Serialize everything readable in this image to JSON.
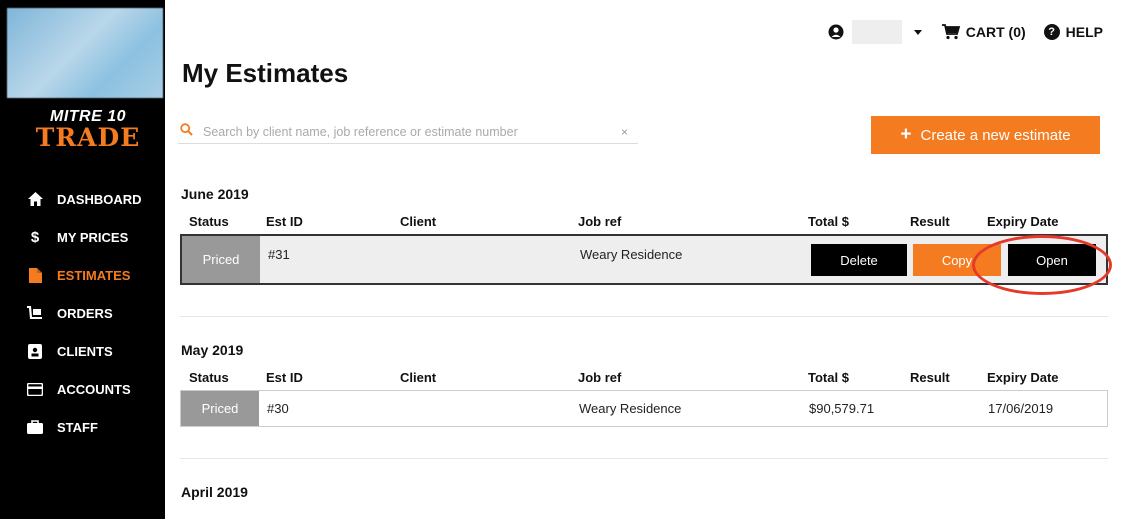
{
  "sidebar": {
    "logo_top": "MITRE 10",
    "logo_bottom": "TRADE",
    "items": [
      {
        "label": "DASHBOARD"
      },
      {
        "label": "MY PRICES"
      },
      {
        "label": "ESTIMATES"
      },
      {
        "label": "ORDERS"
      },
      {
        "label": "CLIENTS"
      },
      {
        "label": "ACCOUNTS"
      },
      {
        "label": "STAFF"
      }
    ],
    "active_item": "ESTIMATES"
  },
  "topbar": {
    "cart_label": "CART (0)",
    "help_label": "HELP"
  },
  "main": {
    "title": "My Estimates",
    "search_placeholder": "Search by client name, job reference or estimate number",
    "search_clear": "×",
    "create_label": "Create a new estimate",
    "create_plus": "+",
    "headers": {
      "status": "Status",
      "est_id": "Est ID",
      "client": "Client",
      "job_ref": "Job ref",
      "total": "Total $",
      "result": "Result",
      "expiry": "Expiry Date"
    },
    "sections": [
      {
        "month": "June 2019",
        "rows": [
          {
            "status": "Priced",
            "est_id": "#31",
            "client": "",
            "job_ref": "Weary Residence",
            "delete_label": "Delete",
            "copy_label": "Copy",
            "open_label": "Open"
          }
        ]
      },
      {
        "month": "May 2019",
        "rows": [
          {
            "status": "Priced",
            "est_id": "#30",
            "client": "",
            "job_ref": "Weary Residence",
            "total": "$90,579.71",
            "result": "",
            "expiry": "17/06/2019"
          }
        ]
      },
      {
        "month": "April 2019"
      }
    ]
  },
  "colors": {
    "accent": "#f47b20",
    "sidebar_bg": "#000000",
    "highlight": "#e53a2a"
  }
}
